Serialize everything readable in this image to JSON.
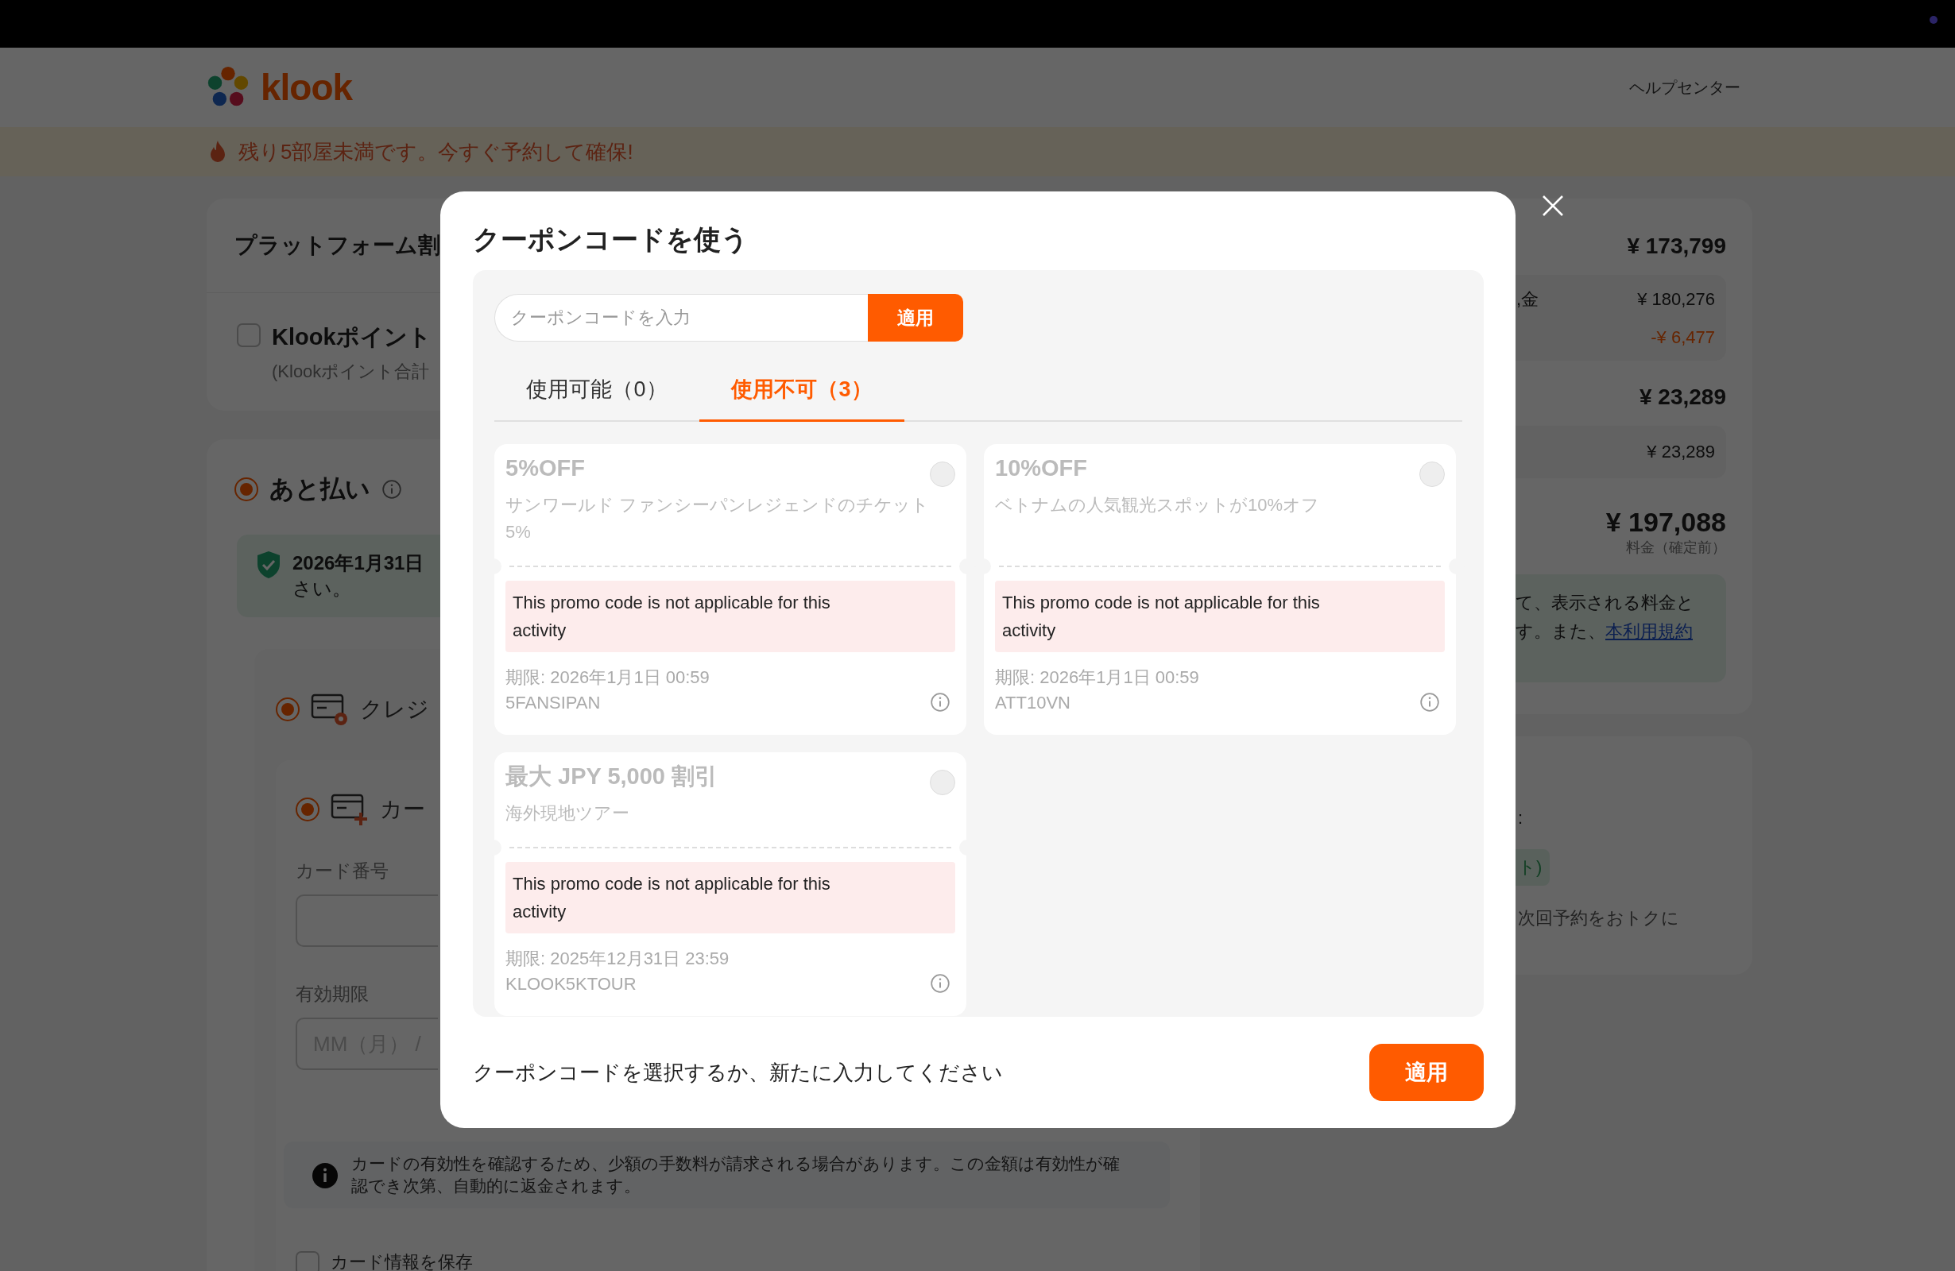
{
  "header": {
    "logo_text": "klook",
    "help_link": "ヘルプセンター"
  },
  "banner": {
    "text": "残り5部屋未満です。今すぐ予約して確保!"
  },
  "left": {
    "discount_title": "プラットフォーム割",
    "points": {
      "checked": false,
      "label": "Klookポイント",
      "sub": "(Klookポイント合計"
    },
    "pay_later": {
      "selected": true,
      "label": "あと払い",
      "notice_lines": [
        "2026年1月31日",
        "さい。"
      ]
    },
    "credit": {
      "selected": true,
      "label": "クレジ"
    },
    "card": {
      "selected": true,
      "label": "カー",
      "number_label": "カード番号",
      "expiry_label": "有効期限",
      "expiry_placeholder": "MM（月） /"
    },
    "fee_notice": "カードの有効性を確認するため、少額の手数料が請求される場合があります。この金額は有効性が確認でき次第、自動的に返金されます。",
    "save_card": {
      "checked": false,
      "label": "カード情報を保存"
    }
  },
  "summary": {
    "subtotal": "¥ 173,799",
    "fee_label": ",金",
    "fee": "¥ 180,276",
    "discount": "-¥ 6,477",
    "tax": "¥ 23,289",
    "tax_detail": "¥ 23,289",
    "total": "¥ 197,088",
    "total_note": "料金（確定前）",
    "terms_line": "て、表示される料金と",
    "terms_prefix": "す。また、",
    "terms_link": "本利用規約"
  },
  "points_card": {
    "colon": ":",
    "pill": "ト)",
    "text": "次回予約をおトクに"
  },
  "modal": {
    "title": "クーポンコードを使う",
    "input": {
      "placeholder": "クーポンコードを入力",
      "button": "適用"
    },
    "tabs": [
      {
        "label": "使用可能（0）",
        "selected": false
      },
      {
        "label": "使用不可（3）",
        "selected": true
      }
    ],
    "coupons": [
      {
        "title": "5%OFF",
        "description": "サンワールド ファンシーパンレジェンドのチケット5%",
        "selected": false,
        "error": "This promo code is not applicable for this activity",
        "expiry": "期限: 2026年1月1日 00:59",
        "code": "5FANSIPAN"
      },
      {
        "title": "10%OFF",
        "description": "ベトナムの人気観光スポットが10%オフ",
        "selected": false,
        "error": "This promo code is not applicable for this activity",
        "expiry": "期限: 2026年1月1日 00:59",
        "code": "ATT10VN"
      },
      {
        "title": "最大 JPY 5,000 割引",
        "description": "海外現地ツアー",
        "selected": false,
        "error": "This promo code is not applicable for this activity",
        "expiry": "期限: 2025年12月31日 23:59",
        "code": "KLOOK5KTOUR"
      }
    ],
    "footer_text": "クーポンコードを選択するか、新たに入力してください",
    "apply_button": "適用"
  }
}
